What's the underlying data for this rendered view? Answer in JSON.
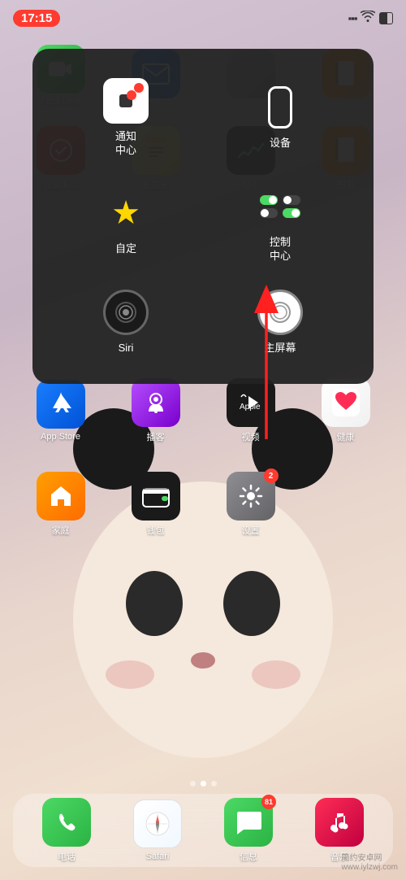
{
  "status": {
    "time": "17:15",
    "signal": "📶",
    "wifi": "WiFi",
    "battery": "🔋"
  },
  "overlay": {
    "items": [
      {
        "id": "notification",
        "label": "通知\n中心",
        "type": "notification"
      },
      {
        "id": "device",
        "label": "设备",
        "type": "device"
      },
      {
        "id": "customize",
        "label": "自定",
        "type": "star"
      },
      {
        "id": "siri",
        "label": "Siri",
        "type": "siri"
      },
      {
        "id": "homescreen",
        "label": "主屏幕",
        "type": "home"
      },
      {
        "id": "controlcenter",
        "label": "控制\n中心",
        "type": "control"
      }
    ]
  },
  "apps": {
    "row1": [
      {
        "label": "FaceTime",
        "bg": "facetime",
        "icon": "📹"
      },
      {
        "label": "",
        "bg": "mail",
        "icon": "✉️"
      },
      {
        "label": "",
        "bg": "notes",
        "icon": "📝"
      },
      {
        "label": "",
        "bg": "books",
        "icon": "📚"
      }
    ],
    "row2": [
      {
        "label": "提醒事项",
        "bg": "reminders",
        "icon": "⏰"
      },
      {
        "label": "备忘录",
        "bg": "notes",
        "icon": "📒"
      },
      {
        "label": "股市",
        "bg": "stocks",
        "icon": "📈"
      },
      {
        "label": "图书",
        "bg": "books",
        "icon": "📚"
      }
    ],
    "row3": [
      {
        "label": "App Store",
        "bg": "appstore",
        "icon": "🅐"
      },
      {
        "label": "播客",
        "bg": "podcasts",
        "icon": "🎙"
      },
      {
        "label": "视频",
        "bg": "appletv",
        "icon": "▶"
      },
      {
        "label": "健康",
        "bg": "health",
        "icon": "❤"
      }
    ],
    "row4": [
      {
        "label": "家庭",
        "bg": "home",
        "icon": "🏠"
      },
      {
        "label": "钱包",
        "bg": "wallet",
        "icon": "💳"
      },
      {
        "label": "设置",
        "bg": "settings",
        "icon": "⚙",
        "badge": "2"
      },
      {
        "label": "",
        "bg": "",
        "icon": ""
      }
    ],
    "dock": [
      {
        "label": "电话",
        "bg": "phone",
        "icon": "📞"
      },
      {
        "label": "Safari",
        "bg": "safari",
        "icon": "🧭"
      },
      {
        "label": "信息",
        "bg": "messages",
        "icon": "💬",
        "badge": "81"
      },
      {
        "label": "音乐",
        "bg": "music",
        "icon": "🎵"
      }
    ]
  },
  "watermark": {
    "line1": "简约安卓网",
    "line2": "www.iylzwj.com"
  },
  "pageDots": {
    "count": 3,
    "active": 1
  }
}
